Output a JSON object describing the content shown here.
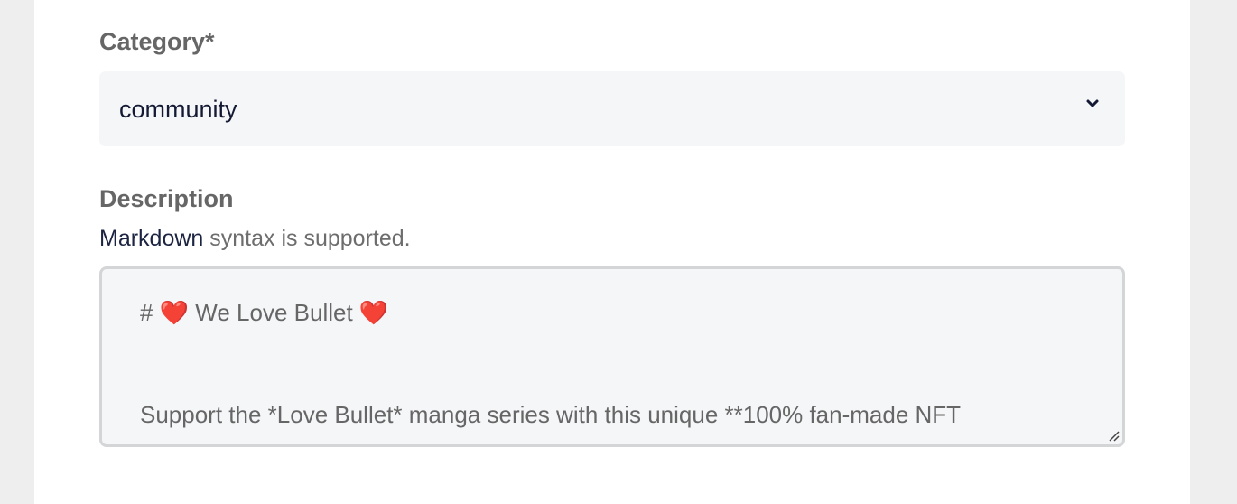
{
  "form": {
    "category": {
      "label": "Category*",
      "selected": "community"
    },
    "description": {
      "label": "Description",
      "helper_link": "Markdown",
      "helper_text": " syntax is supported.",
      "value_lines": [
        "# ❤️ We Love Bullet ❤️",
        "Support the *Love Bullet* manga series with this unique **100% fan-made NFT"
      ]
    }
  },
  "icons": {
    "select_arrow": "chevron-down-icon",
    "resize": "resize-handle-icon"
  },
  "colors": {
    "label": "#666666",
    "input_bg": "#f5f6f8",
    "input_border": "#d4d5d7",
    "link": "#1c2442"
  }
}
